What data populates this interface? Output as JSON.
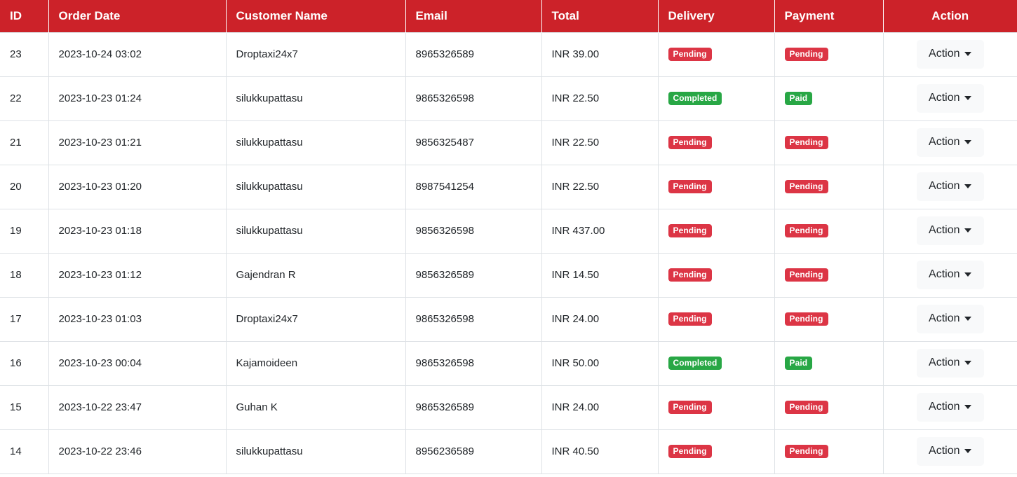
{
  "table": {
    "name": "orders-table",
    "columns": [
      {
        "key": "id",
        "label": "ID"
      },
      {
        "key": "date",
        "label": "Order Date"
      },
      {
        "key": "customer",
        "label": "Customer Name"
      },
      {
        "key": "email",
        "label": "Email"
      },
      {
        "key": "total",
        "label": "Total"
      },
      {
        "key": "delivery",
        "label": "Delivery"
      },
      {
        "key": "payment",
        "label": "Payment"
      },
      {
        "key": "action",
        "label": "Action"
      }
    ],
    "action_button_label": "Action",
    "rows": [
      {
        "id": "23",
        "date": "2023-10-24 03:02",
        "customer": "Droptaxi24x7",
        "email": "8965326589",
        "total": "INR 39.00",
        "delivery": {
          "label": "Pending",
          "variant": "danger"
        },
        "payment": {
          "label": "Pending",
          "variant": "danger"
        }
      },
      {
        "id": "22",
        "date": "2023-10-23 01:24",
        "customer": "silukkupattasu",
        "email": "9865326598",
        "total": "INR 22.50",
        "delivery": {
          "label": "Completed",
          "variant": "success"
        },
        "payment": {
          "label": "Paid",
          "variant": "success"
        }
      },
      {
        "id": "21",
        "date": "2023-10-23 01:21",
        "customer": "silukkupattasu",
        "email": "9856325487",
        "total": "INR 22.50",
        "delivery": {
          "label": "Pending",
          "variant": "danger"
        },
        "payment": {
          "label": "Pending",
          "variant": "danger"
        }
      },
      {
        "id": "20",
        "date": "2023-10-23 01:20",
        "customer": "silukkupattasu",
        "email": "8987541254",
        "total": "INR 22.50",
        "delivery": {
          "label": "Pending",
          "variant": "danger"
        },
        "payment": {
          "label": "Pending",
          "variant": "danger"
        }
      },
      {
        "id": "19",
        "date": "2023-10-23 01:18",
        "customer": "silukkupattasu",
        "email": "9856326598",
        "total": "INR 437.00",
        "delivery": {
          "label": "Pending",
          "variant": "danger"
        },
        "payment": {
          "label": "Pending",
          "variant": "danger"
        }
      },
      {
        "id": "18",
        "date": "2023-10-23 01:12",
        "customer": "Gajendran R",
        "email": "9856326589",
        "total": "INR 14.50",
        "delivery": {
          "label": "Pending",
          "variant": "danger"
        },
        "payment": {
          "label": "Pending",
          "variant": "danger"
        }
      },
      {
        "id": "17",
        "date": "2023-10-23 01:03",
        "customer": "Droptaxi24x7",
        "email": "9865326598",
        "total": "INR 24.00",
        "delivery": {
          "label": "Pending",
          "variant": "danger"
        },
        "payment": {
          "label": "Pending",
          "variant": "danger"
        }
      },
      {
        "id": "16",
        "date": "2023-10-23 00:04",
        "customer": "Kajamoideen",
        "email": "9865326598",
        "total": "INR 50.00",
        "delivery": {
          "label": "Completed",
          "variant": "success"
        },
        "payment": {
          "label": "Paid",
          "variant": "success"
        }
      },
      {
        "id": "15",
        "date": "2023-10-22 23:47",
        "customer": "Guhan K",
        "email": "9865326589",
        "total": "INR 24.00",
        "delivery": {
          "label": "Pending",
          "variant": "danger"
        },
        "payment": {
          "label": "Pending",
          "variant": "danger"
        }
      },
      {
        "id": "14",
        "date": "2023-10-22 23:46",
        "customer": "silukkupattasu",
        "email": "8956236589",
        "total": "INR 40.50",
        "delivery": {
          "label": "Pending",
          "variant": "danger"
        },
        "payment": {
          "label": "Pending",
          "variant": "danger"
        }
      }
    ]
  },
  "colors": {
    "header_background": "#cc2229",
    "badge_danger": "#dc3545",
    "badge_success": "#28a745",
    "action_button_background": "#f8f9fa",
    "cell_border": "#dee2e6"
  },
  "icons": {
    "caret_down": "caret-down-icon"
  }
}
